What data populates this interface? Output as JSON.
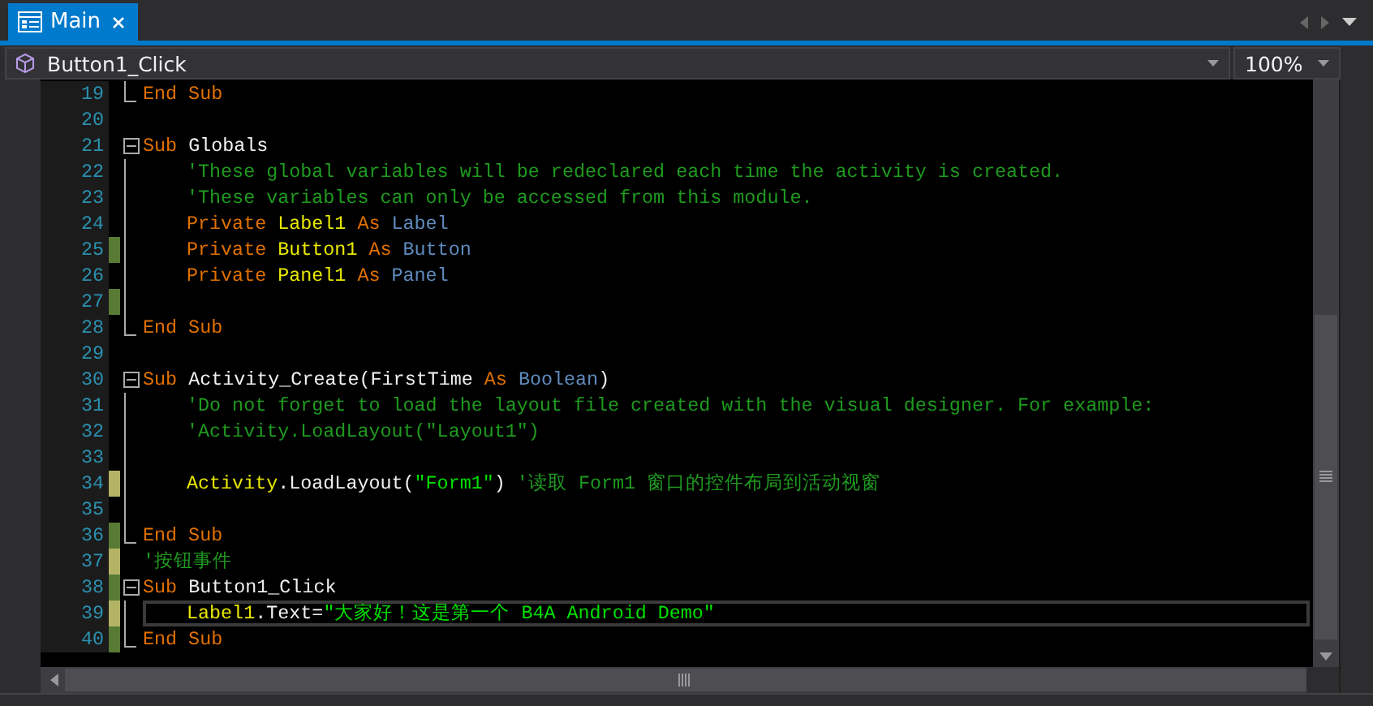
{
  "tabs": [
    {
      "label": "Main",
      "selected": true
    }
  ],
  "header": {
    "member": "Button1_Click",
    "zoom": "100%"
  },
  "lines": [
    {
      "number": "19",
      "kind": "end",
      "current": false,
      "tokens": [
        {
          "kind": "keyword",
          "text": "End Sub"
        }
      ]
    },
    {
      "number": "20",
      "kind": "plain",
      "current": false
    },
    {
      "number": "21",
      "kind": "start",
      "current": false,
      "tokens": [
        {
          "kind": "keyword",
          "text": "Sub "
        },
        {
          "kind": "ident",
          "text": "Globals"
        }
      ]
    },
    {
      "number": "22",
      "kind": "body",
      "current": false,
      "tokens": [
        {
          "kind": "comment",
          "text": "'These global variables will be redeclared each time the activity is created."
        }
      ]
    },
    {
      "number": "23",
      "kind": "body",
      "current": false,
      "tokens": [
        {
          "kind": "comment",
          "text": "'These variables can only be accessed from this module."
        }
      ]
    },
    {
      "number": "24",
      "kind": "body",
      "current": false,
      "tokens": [
        {
          "kind": "keyword",
          "text": "Private "
        },
        {
          "kind": "variable",
          "text": "Label1"
        },
        {
          "kind": "keyword",
          "text": " As "
        },
        {
          "kind": "type",
          "text": "Label"
        }
      ]
    },
    {
      "number": "25",
      "color": "#587a34",
      "kind": "body",
      "current": false,
      "tokens": [
        {
          "kind": "keyword",
          "text": "Private "
        },
        {
          "kind": "variable",
          "text": "Button1"
        },
        {
          "kind": "keyword",
          "text": " As "
        },
        {
          "kind": "type",
          "text": "Button"
        }
      ]
    },
    {
      "number": "26",
      "kind": "body",
      "current": false,
      "tokens": [
        {
          "kind": "keyword",
          "text": "Private "
        },
        {
          "kind": "variable",
          "text": "Panel1"
        },
        {
          "kind": "keyword",
          "text": " As "
        },
        {
          "kind": "type",
          "text": "Panel"
        }
      ]
    },
    {
      "number": "27",
      "color": "#587a34",
      "kind": "body",
      "current": false
    },
    {
      "number": "28",
      "kind": "end",
      "current": false,
      "tokens": [
        {
          "kind": "keyword",
          "text": "End Sub"
        }
      ]
    },
    {
      "number": "29",
      "kind": "plain",
      "current": false
    },
    {
      "number": "30",
      "kind": "start",
      "current": false,
      "tokens": [
        {
          "kind": "keyword",
          "text": "Sub "
        },
        {
          "kind": "ident",
          "text": "Activity_Create(FirstTime "
        },
        {
          "kind": "keyword",
          "text": "As "
        },
        {
          "kind": "type",
          "text": "Boolean"
        },
        {
          "kind": "ident",
          "text": ")"
        }
      ]
    },
    {
      "number": "31",
      "kind": "body",
      "current": false,
      "tokens": [
        {
          "kind": "comment",
          "text": "'Do not forget to load the layout file created with the visual designer. For example:"
        }
      ]
    },
    {
      "number": "32",
      "kind": "body",
      "current": false,
      "tokens": [
        {
          "kind": "comment",
          "text": "'Activity.LoadLayout(\"Layout1\")"
        }
      ]
    },
    {
      "number": "33",
      "kind": "body",
      "current": false
    },
    {
      "number": "34",
      "color": "#b3b366",
      "kind": "body",
      "current": false,
      "tokens": [
        {
          "kind": "variable",
          "text": "Activity"
        },
        {
          "kind": "ident",
          "text": ".LoadLayout("
        },
        {
          "kind": "string",
          "text": "\"Form1\""
        },
        {
          "kind": "ident",
          "text": ") "
        },
        {
          "kind": "comment",
          "text": "'读取 Form1 窗口的控件布局到活动视窗"
        }
      ]
    },
    {
      "number": "35",
      "kind": "body",
      "current": false
    },
    {
      "number": "36",
      "color": "#587a34",
      "kind": "end",
      "current": false,
      "tokens": [
        {
          "kind": "keyword",
          "text": "End Sub"
        }
      ]
    },
    {
      "number": "37",
      "color": "#b3b366",
      "kind": "plain",
      "current": false,
      "tokens": [
        {
          "kind": "comment",
          "text": "'按钮事件"
        }
      ]
    },
    {
      "number": "38",
      "color": "#587a34",
      "kind": "start",
      "current": false,
      "tokens": [
        {
          "kind": "keyword",
          "text": "Sub "
        },
        {
          "kind": "ident",
          "text": "Button1_Click"
        }
      ]
    },
    {
      "number": "39",
      "color": "#b3b366",
      "kind": "body",
      "current": true,
      "tokens": [
        {
          "kind": "variable",
          "text": "Label1"
        },
        {
          "kind": "ident",
          "text": ".Text="
        },
        {
          "kind": "string",
          "text": "\"大家好！这是第一个 B4A Android Demo\""
        }
      ]
    },
    {
      "number": "40",
      "color": "#587a34",
      "kind": "end",
      "current": false,
      "tokens": [
        {
          "kind": "keyword",
          "text": "End Sub"
        }
      ]
    }
  ]
}
